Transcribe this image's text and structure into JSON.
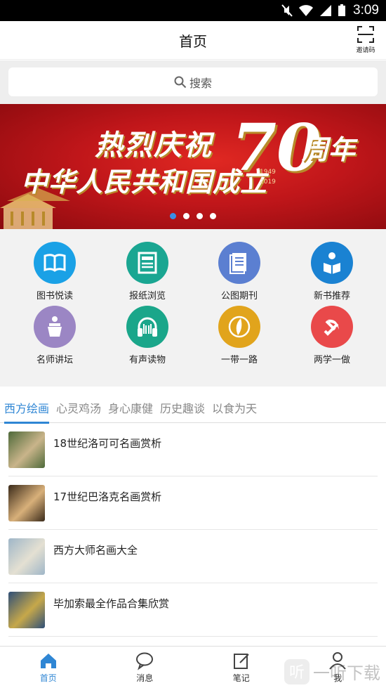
{
  "status_bar": {
    "time": "3:09"
  },
  "header": {
    "title": "首页",
    "invite_label": "邀请码"
  },
  "search": {
    "placeholder": "搜索"
  },
  "banner": {
    "line1": "热烈庆祝",
    "line2": "中华人民共和国成立",
    "number": "70",
    "year_start": "1949",
    "year_end": "2019",
    "suffix": "周年",
    "slides": 4,
    "active_slide": 1
  },
  "grid": [
    {
      "label": "图书悦读",
      "icon": "book-icon",
      "color": "#1aa1e6"
    },
    {
      "label": "报纸浏览",
      "icon": "newspaper-icon",
      "color": "#1aa692"
    },
    {
      "label": "公图期刊",
      "icon": "journal-icon",
      "color": "#5b7fd1"
    },
    {
      "label": "新书推荐",
      "icon": "reader-icon",
      "color": "#1a82d2"
    },
    {
      "label": "名师讲坛",
      "icon": "podium-icon",
      "color": "#9b86c4"
    },
    {
      "label": "有声读物",
      "icon": "headphones-icon",
      "color": "#1aa68a"
    },
    {
      "label": "一带一路",
      "icon": "silk-road-icon",
      "color": "#e1a41c"
    },
    {
      "label": "两学一做",
      "icon": "party-emblem-icon",
      "color": "#e9494a"
    }
  ],
  "tabs": [
    "西方绘画",
    "心灵鸡汤",
    "身心康健",
    "历史趣谈",
    "以食为天"
  ],
  "active_tab": 0,
  "list": [
    {
      "title": "18世纪洛可可名画赏析",
      "colors": [
        "#4e6a3a",
        "#c9b48a"
      ]
    },
    {
      "title": "17世纪巴洛克名画赏析",
      "colors": [
        "#3a2a1a",
        "#d8b07a"
      ]
    },
    {
      "title": "西方大师名画大全",
      "colors": [
        "#9fb6c8",
        "#e4e0d2"
      ]
    },
    {
      "title": "毕加索最全作品合集欣赏",
      "colors": [
        "#2f4f78",
        "#c6a84a"
      ]
    }
  ],
  "bottom_nav": [
    {
      "label": "首页",
      "icon": "home-icon",
      "active": true
    },
    {
      "label": "消息",
      "icon": "message-icon",
      "active": false
    },
    {
      "label": "笔记",
      "icon": "note-icon",
      "active": false
    },
    {
      "label": "我",
      "icon": "user-icon",
      "active": false
    }
  ],
  "watermark": {
    "text": "一听下载",
    "glyph": "听"
  }
}
